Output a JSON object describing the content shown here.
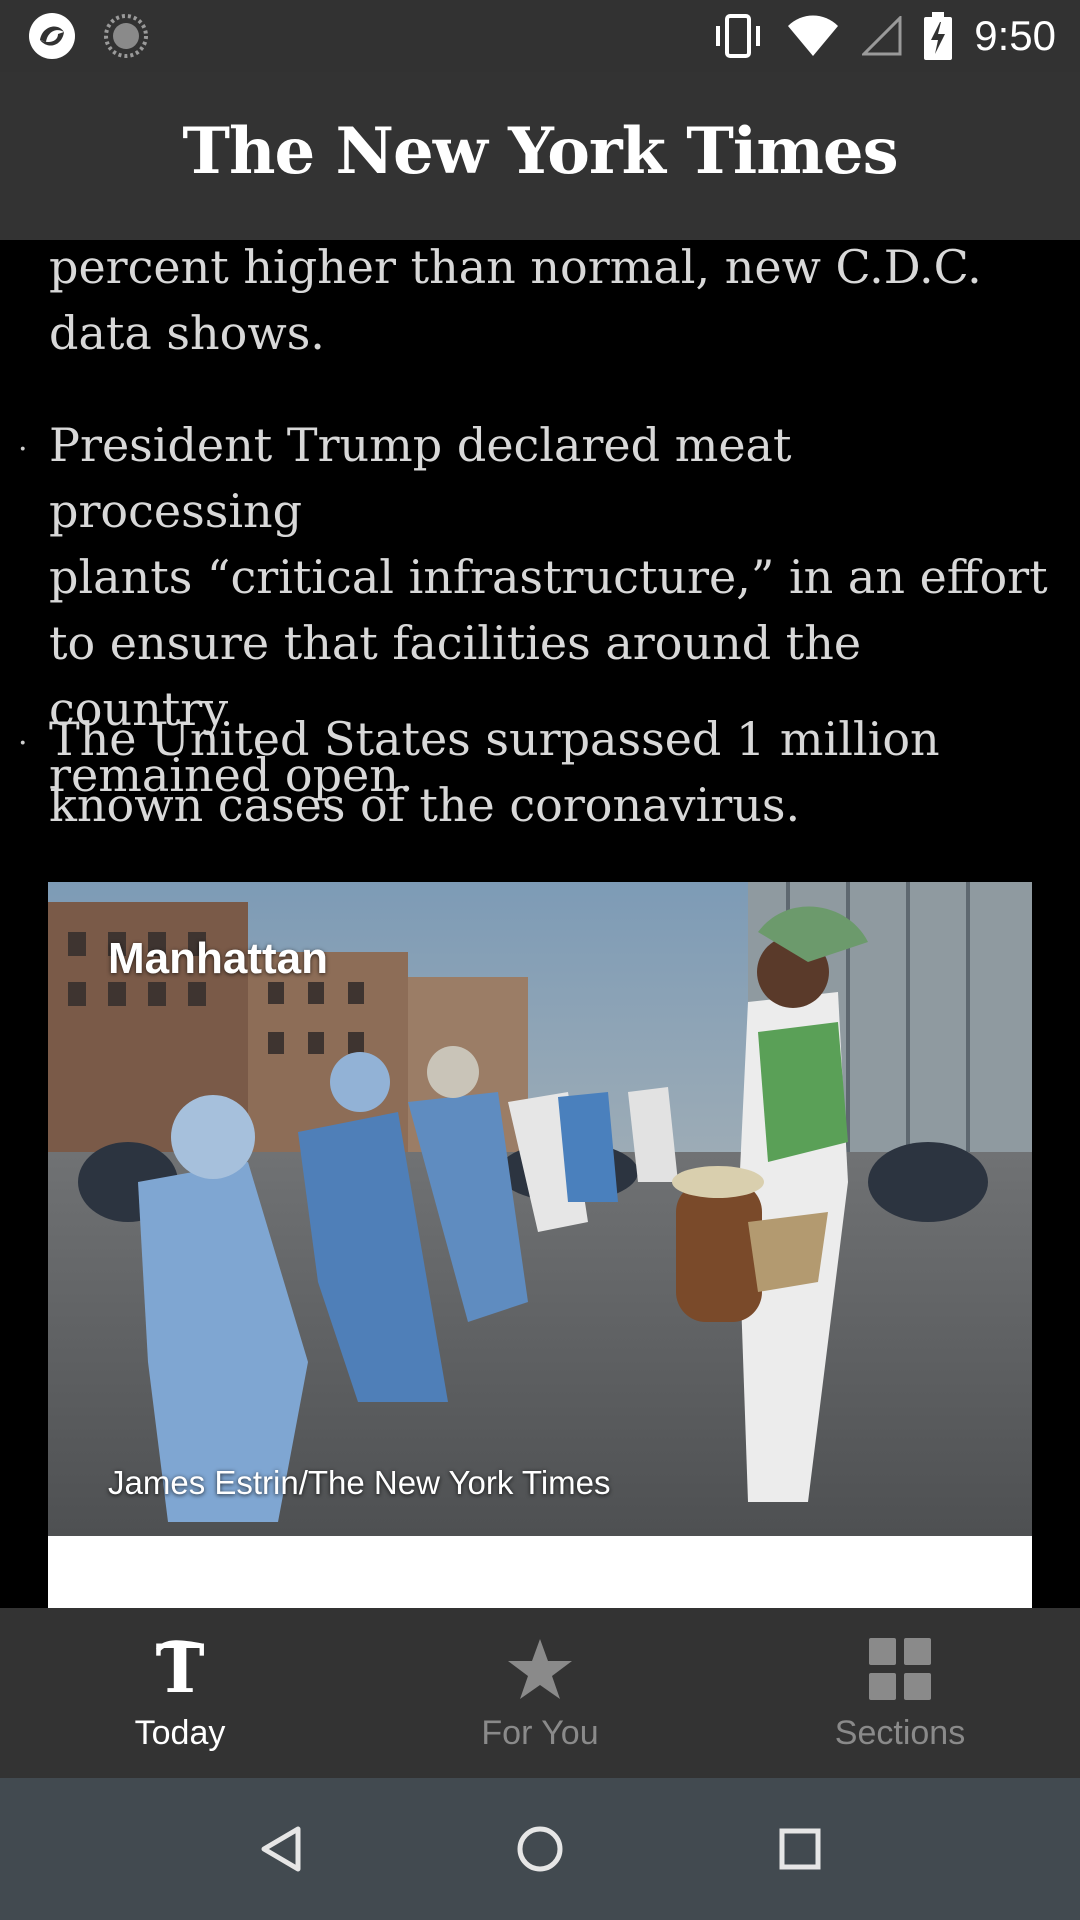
{
  "status_bar": {
    "time": "9:50",
    "left_icons": [
      "app-notification-icon",
      "sync-notification-icon"
    ],
    "right_icons": [
      "vibrate-icon",
      "wifi-icon",
      "cell-signal-icon",
      "battery-charging-icon"
    ]
  },
  "header": {
    "masthead": "The New York Times"
  },
  "article": {
    "paragraphs": [
      {
        "bullet": "",
        "line1": "percent higher than normal, new C.D.C.",
        "line2": "data shows."
      },
      {
        "bullet": "·",
        "line1": "President Trump declared meat processing",
        "line2": "plants “critical infrastructure,” in an effort",
        "line3": "to ensure that facilities around the country",
        "line4": "remained open."
      },
      {
        "bullet": "·",
        "line1": "The United States surpassed 1 million",
        "line2": "known cases of the coronavirus."
      }
    ],
    "photo": {
      "location": "Manhattan",
      "credit": "James Estrin/The New York Times"
    }
  },
  "bottom_nav": {
    "items": [
      {
        "label": "Today",
        "icon": "nyt-t-icon",
        "active": true
      },
      {
        "label": "For You",
        "icon": "star-icon",
        "active": false
      },
      {
        "label": "Sections",
        "icon": "grid-icon",
        "active": false
      }
    ]
  },
  "system_nav": {
    "buttons": [
      "back-icon",
      "home-icon",
      "recents-icon"
    ]
  },
  "colors": {
    "bars": "#333333",
    "background": "#000000",
    "body_text": "#d8d8d8",
    "active_tab": "#ffffff",
    "inactive_tab": "#8a8a8a",
    "system_nav": "#424a50"
  }
}
